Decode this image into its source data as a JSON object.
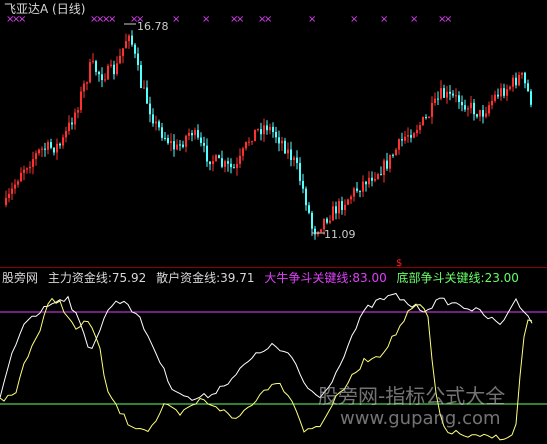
{
  "header": {
    "title": "飞亚达A (日线)"
  },
  "price_panel": {
    "high_label": "16.78",
    "low_label": "11.09",
    "signal_label": "$",
    "marker_glyph": "×",
    "up_color": "#ff3030",
    "down_color": "#54ffff",
    "marker_color": "#e040fb",
    "signal_color": "#ff2020"
  },
  "indicator": {
    "items": [
      {
        "key": "site",
        "text": "股旁网",
        "color": "#d8d8d8"
      },
      {
        "key": "main",
        "text": "主力资金线:75.92",
        "color": "#d8d8d8"
      },
      {
        "key": "retail",
        "text": "散户资金线:39.71",
        "color": "#d8d8d8"
      },
      {
        "key": "bull",
        "text": "大牛争斗关键线:83.00",
        "color": "#e040fb"
      },
      {
        "key": "bottom",
        "text": "底部争斗关键线:23.00",
        "color": "#66ff66"
      }
    ],
    "line_colors": {
      "main": "#ffffff",
      "retail": "#ffff7a",
      "bull": "#e040fb",
      "bottom": "#66ff66"
    }
  },
  "watermark": {
    "line1": "股旁网-指标公式大全",
    "line2": "www.gupang.com"
  }
}
